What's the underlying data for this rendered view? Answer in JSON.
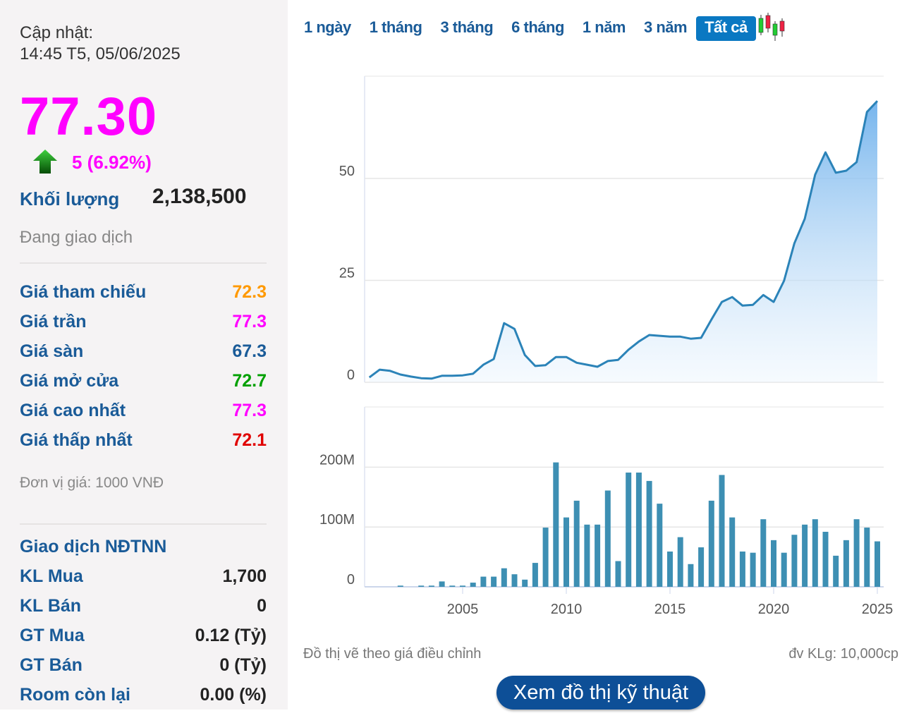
{
  "info": {
    "updated_label": "Cập nhật:",
    "updated_time": "14:45 T5, 05/06/2025",
    "price": "77.30",
    "change": "5 (6.92%)",
    "volume_label": "Khối lượng",
    "volume": "2,138,500",
    "status": "Đang giao dịch",
    "prices": [
      {
        "label": "Giá tham chiếu",
        "value": "72.3",
        "color": "#ff9900"
      },
      {
        "label": "Giá trần",
        "value": "77.3",
        "color": "#ff00ff"
      },
      {
        "label": "Giá sàn",
        "value": "67.3",
        "color": "#1a5b98"
      },
      {
        "label": "Giá mở cửa",
        "value": "72.7",
        "color": "#00a000"
      },
      {
        "label": "Giá cao nhất",
        "value": "77.3",
        "color": "#ff00ff"
      },
      {
        "label": "Giá thấp nhất",
        "value": "72.1",
        "color": "#e00000"
      }
    ],
    "unit": "Đơn vị giá: 1000 VNĐ",
    "foreign_title": "Giao dịch NĐTNN",
    "foreign": [
      {
        "label": "KL Mua",
        "value": "1,700"
      },
      {
        "label": "KL Bán",
        "value": "0"
      },
      {
        "label": "GT Mua",
        "value": "0.12 (Tỷ)"
      },
      {
        "label": "GT Bán",
        "value": "0 (Tỷ)"
      },
      {
        "label": "Room còn lại",
        "value": "0.00 (%)"
      }
    ]
  },
  "tabs": [
    {
      "label": "1 ngày"
    },
    {
      "label": "1 tháng"
    },
    {
      "label": "3 tháng"
    },
    {
      "label": "6 tháng"
    },
    {
      "label": "1 năm"
    },
    {
      "label": "3 năm"
    },
    {
      "label": "Tất cả",
      "active": true
    }
  ],
  "footer": {
    "note": "Đồ thị vẽ theo giá điều chỉnh",
    "volume_unit": "đv KLg: 10,000cp",
    "tech_button": "Xem đồ thị kỹ thuật"
  },
  "chart_data": [
    {
      "type": "area",
      "title": "Price",
      "ylim": [
        0,
        75
      ],
      "yticks": [
        "0",
        "25",
        "50"
      ],
      "ytick_values": [
        0,
        25,
        50
      ],
      "x_start": 2000.5,
      "x_step": 0.5,
      "values": [
        1.2,
        3.1,
        2.8,
        1.9,
        1.4,
        1,
        0.9,
        1.6,
        1.6,
        1.7,
        2.1,
        4.3,
        5.7,
        14.5,
        13.1,
        6.7,
        4,
        4.2,
        6.2,
        6.2,
        4.8,
        4.3,
        3.8,
        5.2,
        5.5,
        8,
        10,
        11.6,
        11.4,
        11.2,
        11.2,
        10.7,
        10.9,
        15.4,
        19.7,
        20.9,
        18.8,
        19,
        21.4,
        19.7,
        24.9,
        34.1,
        40.1,
        50.9,
        56.4,
        51.4,
        51.9,
        54,
        66.3,
        69
      ],
      "color": "#2b83b8"
    },
    {
      "type": "bar",
      "title": "Volume",
      "ylim": [
        0,
        240
      ],
      "yticks": [
        "0",
        "100M",
        "200M"
      ],
      "ytick_values": [
        0,
        100,
        200
      ],
      "x_start": 2002.0,
      "x_step": 0.5,
      "values": [
        2,
        0,
        2,
        2,
        9,
        2,
        2,
        7,
        17,
        17,
        31,
        21,
        12,
        40,
        99,
        208,
        116,
        144,
        104,
        104,
        161,
        43,
        191,
        191,
        177,
        139,
        59,
        83,
        38,
        66,
        144,
        187,
        116,
        59,
        57,
        113,
        78,
        57,
        87,
        104,
        113,
        92,
        52,
        78,
        113,
        99,
        76
      ],
      "color": "#3d8fb3"
    },
    {
      "xticks": [
        "2005",
        "2010",
        "2015",
        "2020",
        "2025"
      ],
      "xtick_values": [
        2005,
        2010,
        2015,
        2020,
        2025
      ]
    }
  ]
}
